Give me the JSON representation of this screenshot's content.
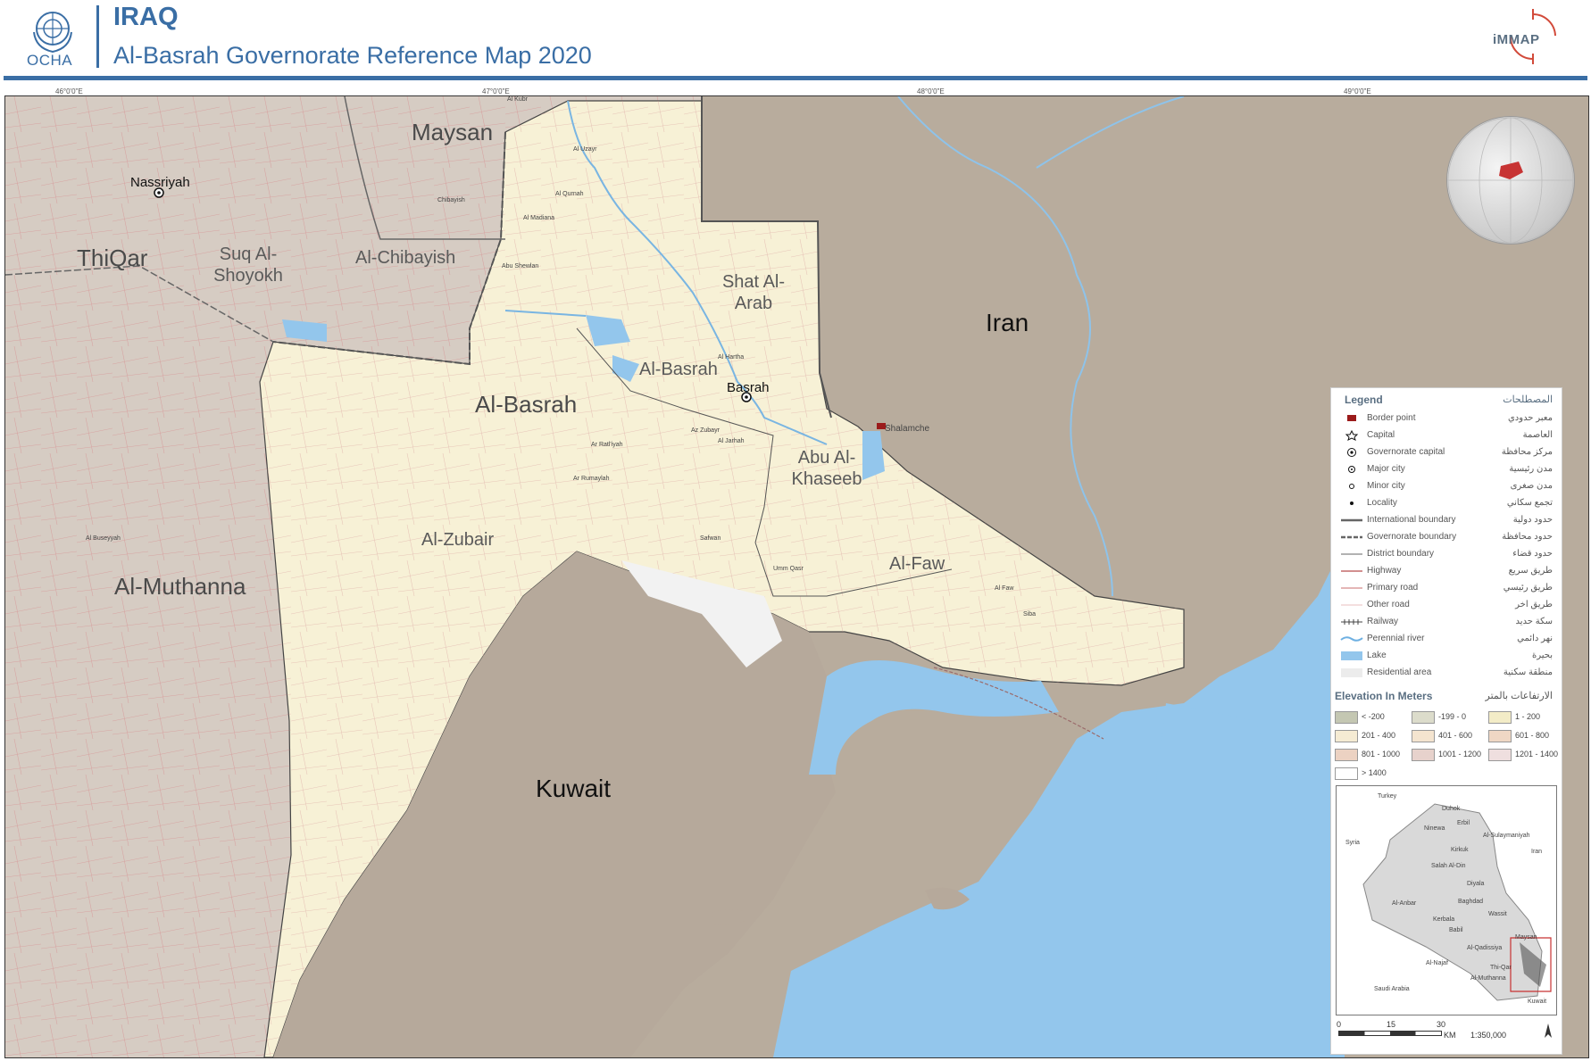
{
  "header": {
    "org": "OCHA",
    "country": "IRAQ",
    "title": "Al-Basrah Governorate Reference Map 2020",
    "partner": "iMMAP",
    "colors": {
      "brand": "#3a6ea5",
      "partner": "#5a6f82",
      "accent": "#d24a3a"
    }
  },
  "ticks": [
    "46°0'0\"E",
    "47°0'0\"E",
    "48°0'0\"E",
    "49°0'0\"E"
  ],
  "map": {
    "countries": [
      "Iran",
      "Kuwait"
    ],
    "governorates": [
      "Maysan",
      "ThiQar",
      "Al-Muthanna",
      "Al-Basrah"
    ],
    "districts": [
      "Shat Al-Arab",
      "Al-Basrah",
      "Abu Al-Khaseeb",
      "Al-Zubair",
      "Al-Faw",
      "Al-Chibayish",
      "Suq Al-Shoyokh"
    ],
    "cities": [
      "Nassriyah",
      "Basrah",
      "Shalamche"
    ],
    "localities": [
      "Al Qurnah",
      "Al Madiana",
      "Az Zubayr",
      "Safwan",
      "Umm Qasr",
      "Al Faw",
      "Al Buseyyah",
      "Ar Ratl'iyah",
      "Ar Rumaylah",
      "Al Uzayr",
      "Al Kubr",
      "Chibayish",
      "Abu Shewlan",
      "Al Jarhah",
      "Al Hartha",
      "Siba"
    ]
  },
  "legend": {
    "title": "Legend",
    "title_ar": "المصطلحات",
    "items": [
      {
        "en": "Border point",
        "ar": "معبر حدودي",
        "icon": "border-point-icon"
      },
      {
        "en": "Capital",
        "ar": "العاصمة",
        "icon": "capital-icon"
      },
      {
        "en": "Governorate capital",
        "ar": "مركز محافظة",
        "icon": "governorate-capital-icon"
      },
      {
        "en": "Major city",
        "ar": "مدن رئيسية",
        "icon": "major-city-icon"
      },
      {
        "en": "Minor city",
        "ar": "مدن صغرى",
        "icon": "minor-city-icon"
      },
      {
        "en": "Locality",
        "ar": "تجمع سكاني",
        "icon": "locality-icon"
      },
      {
        "en": "International boundary",
        "ar": "حدود دولية",
        "icon": "international-boundary-icon"
      },
      {
        "en": "Governorate boundary",
        "ar": "حدود محافظة",
        "icon": "governorate-boundary-icon"
      },
      {
        "en": "District boundary",
        "ar": "حدود قضاء",
        "icon": "district-boundary-icon"
      },
      {
        "en": "Highway",
        "ar": "طريق سريع",
        "icon": "highway-icon"
      },
      {
        "en": "Primary road",
        "ar": "طريق رئيسي",
        "icon": "primary-road-icon"
      },
      {
        "en": "Other road",
        "ar": "طريق اخر",
        "icon": "other-road-icon"
      },
      {
        "en": "Railway",
        "ar": "سكة حديد",
        "icon": "railway-icon"
      },
      {
        "en": "Perennial river",
        "ar": "نهر دائمي",
        "icon": "river-icon"
      },
      {
        "en": "Lake",
        "ar": "بحيرة",
        "icon": "lake-icon"
      },
      {
        "en": "Residential area",
        "ar": "منطقة سكنية",
        "icon": "residential-icon"
      }
    ],
    "elevation_title": "Elevation In Meters",
    "elevation_title_ar": "الارتفاعات بالمتر",
    "elevation": [
      {
        "label": "< -200",
        "color": "#c4c7b2"
      },
      {
        "label": "-199 - 0",
        "color": "#dcdccb"
      },
      {
        "label": "1 - 200",
        "color": "#f3ecc7"
      },
      {
        "label": "201 - 400",
        "color": "#f5ebd3"
      },
      {
        "label": "401 - 600",
        "color": "#f4e4cf"
      },
      {
        "label": "601 - 800",
        "color": "#efd7c4"
      },
      {
        "label": "801 - 1000",
        "color": "#ecd2c2"
      },
      {
        "label": "1001 - 1200",
        "color": "#e7d2cc"
      },
      {
        "label": "1201 - 1400",
        "color": "#efdfdf"
      },
      {
        "label": "> 1400",
        "color": "#ffffff"
      }
    ],
    "inset": {
      "labels": [
        "Turkey",
        "Syria",
        "Iran",
        "Saudi Arabia",
        "Kuwait",
        "Maysan",
        "Ninewa",
        "Erbil",
        "Kirkuk",
        "Salah Al-Din",
        "Diyala",
        "Baghdad",
        "Al-Anbar",
        "Kerbala",
        "Babil",
        "Wassit",
        "Al-Qadissiya",
        "Al-Najaf",
        "Al-Muthanna",
        "Duhok",
        "Al-Sulaymaniyah",
        "Thi-Qar"
      ]
    },
    "scale": {
      "ticks": [
        "0",
        "15",
        "30"
      ],
      "unit": "KM",
      "ratio": "1:350,000"
    }
  }
}
